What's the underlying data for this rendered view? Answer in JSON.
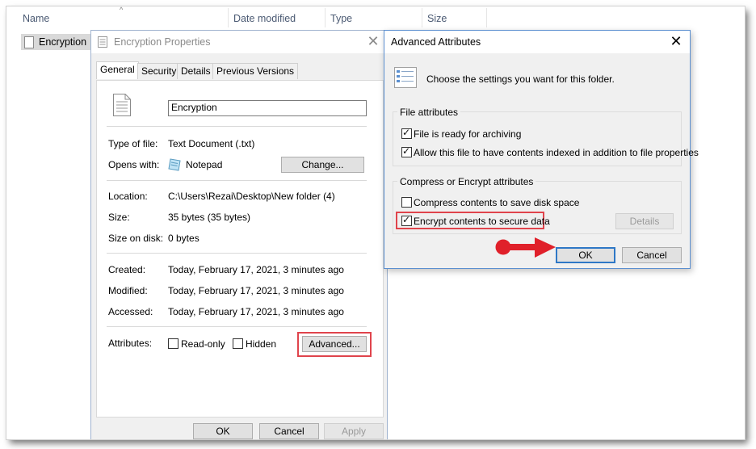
{
  "explorer": {
    "columns": [
      "Name",
      "Date modified",
      "Type",
      "Size"
    ],
    "file_name": "Encryption"
  },
  "properties": {
    "title": "Encryption Properties",
    "tabs": [
      "General",
      "Security",
      "Details",
      "Previous Versions"
    ],
    "active_tab": "General",
    "file_name_value": "Encryption",
    "type_label": "Type of file:",
    "type_value": "Text Document (.txt)",
    "opens_label": "Opens with:",
    "opens_value": "Notepad",
    "change_button": "Change...",
    "location_label": "Location:",
    "location_value": "C:\\Users\\Rezai\\Desktop\\New folder (4)",
    "size_label": "Size:",
    "size_value": "35 bytes (35 bytes)",
    "size_on_disk_label": "Size on disk:",
    "size_on_disk_value": "0 bytes",
    "created_label": "Created:",
    "created_value": "Today, February 17, 2021, 3 minutes ago",
    "modified_label": "Modified:",
    "modified_value": "Today, February 17, 2021, 3 minutes ago",
    "accessed_label": "Accessed:",
    "accessed_value": "Today, February 17, 2021, 3 minutes ago",
    "attributes_label": "Attributes:",
    "readonly_label": "Read-only",
    "hidden_label": "Hidden",
    "advanced_button": "Advanced...",
    "ok_button": "OK",
    "cancel_button": "Cancel",
    "apply_button": "Apply"
  },
  "advanced": {
    "title": "Advanced Attributes",
    "intro": "Choose the settings you want for this folder.",
    "file_attributes_title": "File attributes",
    "archive_label": "File is ready for archiving",
    "archive_checked": true,
    "index_label": "Allow this file to have contents indexed in addition to file properties",
    "index_checked": true,
    "compress_group_title": "Compress or Encrypt attributes",
    "compress_label": "Compress contents to save disk space",
    "compress_checked": false,
    "encrypt_label": "Encrypt contents to secure data",
    "encrypt_checked": true,
    "details_button": "Details",
    "ok_button": "OK",
    "cancel_button": "Cancel"
  },
  "colors": {
    "highlight": "#e0444c",
    "default_button_border": "#2f78c6",
    "arrow": "#e0202a"
  },
  "icons": {
    "file": "text-file-icon",
    "notepad": "notepad-icon",
    "attributes": "attributes-list-icon",
    "close": "close-icon",
    "annotation": "red-arrow-icon"
  }
}
